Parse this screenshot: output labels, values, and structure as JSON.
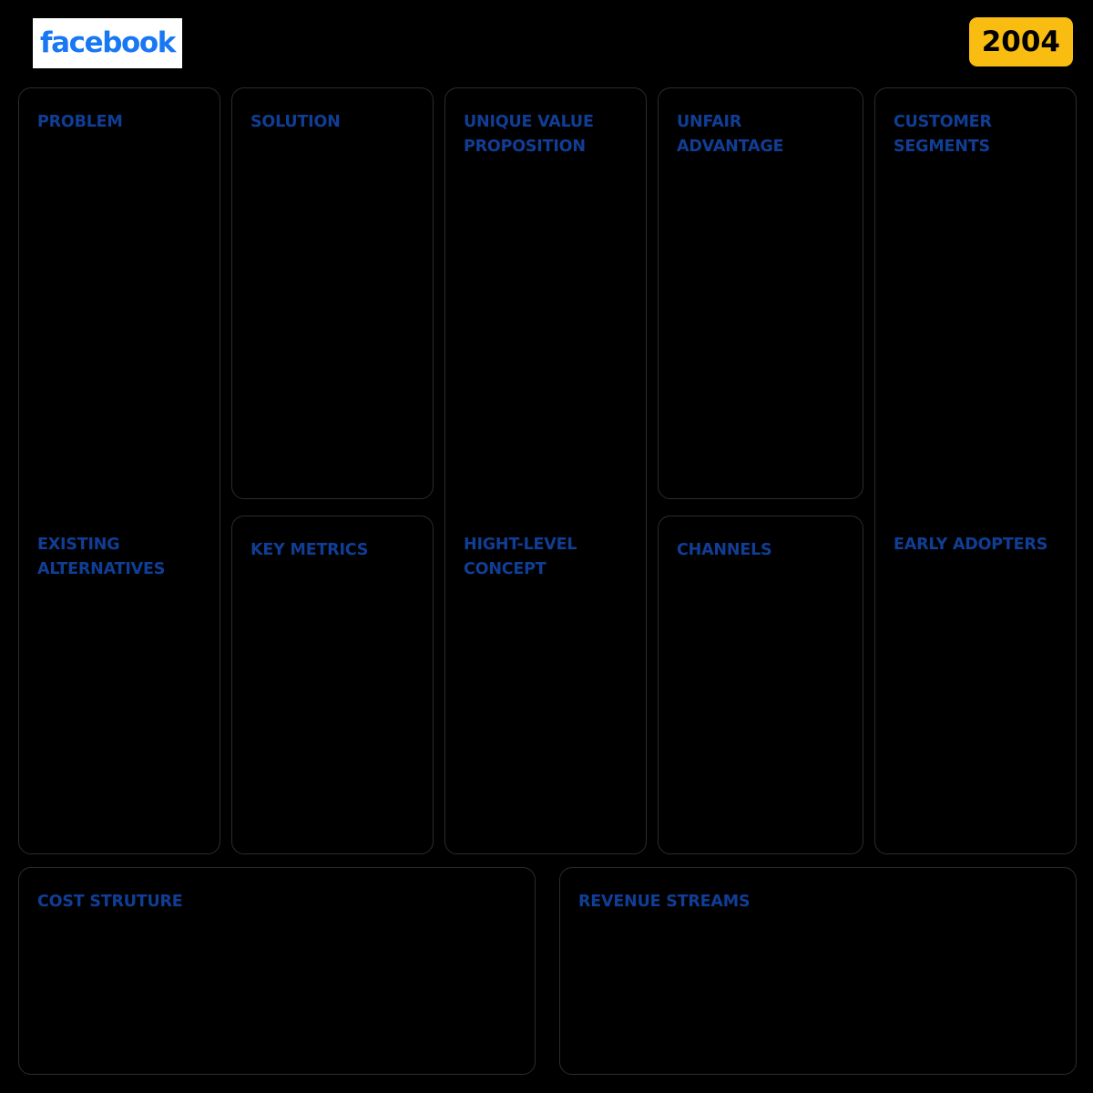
{
  "header": {
    "brand": "facebook",
    "brand_color": "#1877F2",
    "year": "2004",
    "year_badge_color": "#F8BD10"
  },
  "theme": {
    "background": "#000000",
    "card_border": "#2c2c2c",
    "title_color": "#103E96"
  },
  "canvas": {
    "type": "lean-canvas",
    "blocks": {
      "problem": "PROBLEM",
      "existing_alternatives": "EXISTING\nALTERNATIVES",
      "solution": "SOLUTION",
      "key_metrics": "KEY METRICS",
      "unique_value_proposition": "UNIQUE VALUE\nPROPOSITION",
      "high_level_concept": "HIGHT-LEVEL\nCONCEPT",
      "unfair_advantage": "UNFAIR\nADVANTAGE",
      "channels": "CHANNELS",
      "customer_segments": "CUSTOMER\nSEGMENTS",
      "early_adopters": "EARLY ADOPTERS",
      "cost_structure": "COST STRUTURE",
      "revenue_streams": "REVENUE STREAMS"
    }
  }
}
